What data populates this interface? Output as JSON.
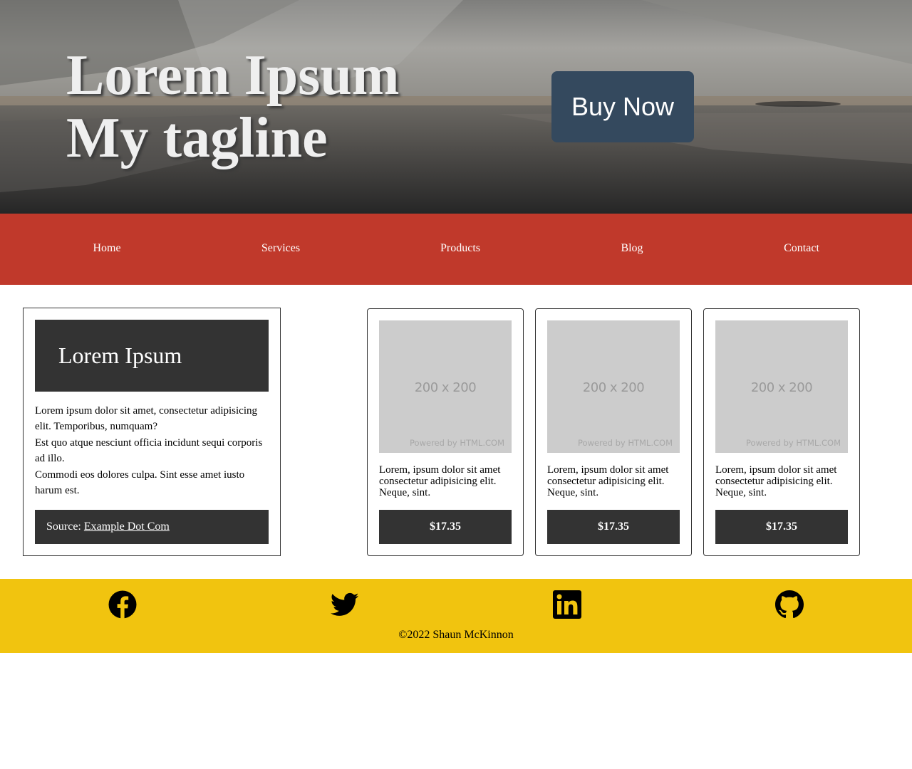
{
  "hero": {
    "title_line1": "Lorem Ipsum",
    "title_line2": "My tagline",
    "buy_button": "Buy Now"
  },
  "nav": {
    "items": [
      {
        "label": "Home"
      },
      {
        "label": "Services"
      },
      {
        "label": "Products"
      },
      {
        "label": "Blog"
      },
      {
        "label": "Contact"
      }
    ]
  },
  "article": {
    "heading": "Lorem Ipsum",
    "paragraphs": [
      "Lorem ipsum dolor sit amet, consectetur adipisicing elit. Temporibus, numquam?",
      "Est quo atque nesciunt officia incidunt sequi corporis ad illo.",
      "Commodi eos dolores culpa. Sint esse amet iusto harum est."
    ],
    "source_label": "Source:",
    "source_link": "Example Dot Com"
  },
  "products": [
    {
      "image_text": "200 x 200",
      "image_credit": "Powered by HTML.COM",
      "description": "Lorem, ipsum dolor sit amet consectetur adipisicing elit. Neque, sint.",
      "price": "$17.35"
    },
    {
      "image_text": "200 x 200",
      "image_credit": "Powered by HTML.COM",
      "description": "Lorem, ipsum dolor sit amet consectetur adipisicing elit. Neque, sint.",
      "price": "$17.35"
    },
    {
      "image_text": "200 x 200",
      "image_credit": "Powered by HTML.COM",
      "description": "Lorem, ipsum dolor sit amet consectetur adipisicing elit. Neque, sint.",
      "price": "$17.35"
    }
  ],
  "footer": {
    "social": [
      "facebook-icon",
      "twitter-icon",
      "linkedin-icon",
      "github-icon"
    ],
    "copyright": "©2022 Shaun McKinnon"
  },
  "colors": {
    "nav_bg": "#c0392b",
    "button_bg": "#34495e",
    "card_dark": "#333333",
    "footer_bg": "#f1c40f",
    "placeholder_bg": "#cccccc"
  }
}
